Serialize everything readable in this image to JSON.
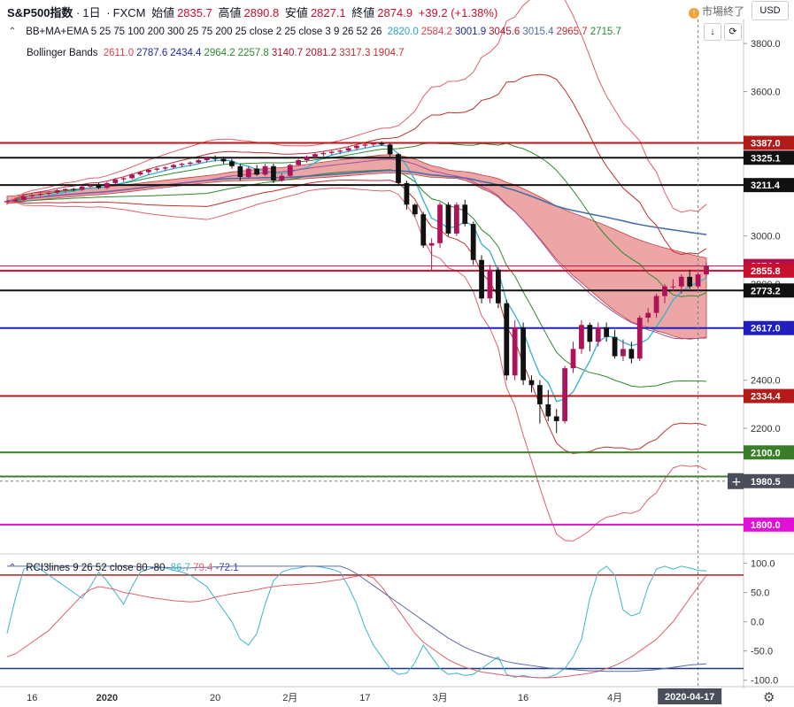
{
  "header": {
    "symbol": "S&P500指数",
    "interval": "1日",
    "source": "FXCM",
    "open_label": "始値",
    "open": "2835.7",
    "high_label": "高値",
    "high": "2890.8",
    "low_label": "安値",
    "low": "2827.1",
    "close_label": "終値",
    "close": "2874.9",
    "change": "+39.2 (+1.38%)",
    "market_status": "市場終了",
    "currency": "USD"
  },
  "indicators": {
    "main_name": "BB+MA+EMA 5 25 75 100 200 300 25 75 200 25 close 2 25 close 3 9 26 52 26",
    "main_values": [
      {
        "v": "2820.0",
        "color": "#26a6c9"
      },
      {
        "v": "2584.2",
        "color": "#e0404a"
      },
      {
        "v": "3001.9",
        "color": "#1e2aa0"
      },
      {
        "v": "3045.6",
        "color": "#b1122c"
      },
      {
        "v": "3015.4",
        "color": "#4a6fa5"
      },
      {
        "v": "2965.7",
        "color": "#c03030"
      },
      {
        "v": "2715.7",
        "color": "#2e8b2e"
      }
    ],
    "bb_name": "Bollinger Bands",
    "bb_values": [
      {
        "v": "2611.0",
        "color": "#e0404a"
      },
      {
        "v": "2787.6",
        "color": "#1e2aa0"
      },
      {
        "v": "2434.4",
        "color": "#1e2aa0"
      },
      {
        "v": "2964.2",
        "color": "#2e8b2e"
      },
      {
        "v": "2257.8",
        "color": "#2e8b2e"
      },
      {
        "v": "3140.7",
        "color": "#b1122c"
      },
      {
        "v": "2081.2",
        "color": "#b1122c"
      },
      {
        "v": "3317.3",
        "color": "#c03030"
      },
      {
        "v": "1904.7",
        "color": "#c03030"
      }
    ],
    "rci_name": "RCI3lines 9 26 52 close 80 -80",
    "rci_values": [
      {
        "v": "86.7",
        "color": "#3cb6cc"
      },
      {
        "v": "79.4",
        "color": "#e0606a"
      },
      {
        "v": "-72.1",
        "color": "#3b4a9a"
      }
    ]
  },
  "chart_data": {
    "type": "candlestick",
    "ylim": [
      1700,
      3900
    ],
    "yticks": [
      1800,
      2000,
      2200,
      2400,
      2600,
      2800,
      3000,
      3200,
      3400,
      3600,
      3800
    ],
    "ytick_labels": [
      "1800.0",
      "",
      "2200.0",
      "2400.0",
      "",
      "2800.0",
      "3000.0",
      "",
      "",
      "3600.0",
      "3800.0"
    ],
    "x_labels": [
      {
        "label": "16",
        "i": 3
      },
      {
        "label": "2020",
        "i": 12,
        "bold": true
      },
      {
        "label": "20",
        "i": 25
      },
      {
        "label": "2月",
        "i": 34
      },
      {
        "label": "17",
        "i": 43
      },
      {
        "label": "3月",
        "i": 52
      },
      {
        "label": "16",
        "i": 62
      },
      {
        "label": "4月",
        "i": 73
      },
      {
        "label": "2020-04-17",
        "i": 82,
        "box": true
      }
    ],
    "candles": [
      [
        3140,
        3150,
        3130,
        3145
      ],
      [
        3145,
        3160,
        3140,
        3150
      ],
      [
        3150,
        3168,
        3145,
        3165
      ],
      [
        3165,
        3175,
        3155,
        3170
      ],
      [
        3170,
        3180,
        3165,
        3175
      ],
      [
        3175,
        3182,
        3168,
        3180
      ],
      [
        3180,
        3195,
        3175,
        3190
      ],
      [
        3190,
        3198,
        3180,
        3195
      ],
      [
        3195,
        3200,
        3185,
        3192
      ],
      [
        3192,
        3210,
        3188,
        3205
      ],
      [
        3205,
        3215,
        3198,
        3210
      ],
      [
        3210,
        3220,
        3195,
        3200
      ],
      [
        3200,
        3225,
        3195,
        3220
      ],
      [
        3220,
        3240,
        3215,
        3235
      ],
      [
        3235,
        3245,
        3225,
        3240
      ],
      [
        3240,
        3260,
        3235,
        3255
      ],
      [
        3255,
        3270,
        3250,
        3265
      ],
      [
        3265,
        3280,
        3255,
        3275
      ],
      [
        3275,
        3285,
        3268,
        3280
      ],
      [
        3280,
        3290,
        3270,
        3285
      ],
      [
        3285,
        3300,
        3280,
        3295
      ],
      [
        3295,
        3305,
        3285,
        3300
      ],
      [
        3300,
        3310,
        3290,
        3305
      ],
      [
        3305,
        3320,
        3300,
        3315
      ],
      [
        3315,
        3330,
        3305,
        3325
      ],
      [
        3325,
        3335,
        3310,
        3320
      ],
      [
        3320,
        3330,
        3300,
        3310
      ],
      [
        3310,
        3320,
        3280,
        3290
      ],
      [
        3290,
        3300,
        3230,
        3245
      ],
      [
        3245,
        3290,
        3240,
        3280
      ],
      [
        3280,
        3295,
        3250,
        3255
      ],
      [
        3255,
        3300,
        3250,
        3290
      ],
      [
        3290,
        3300,
        3220,
        3230
      ],
      [
        3230,
        3260,
        3225,
        3250
      ],
      [
        3250,
        3300,
        3245,
        3295
      ],
      [
        3295,
        3320,
        3290,
        3315
      ],
      [
        3315,
        3335,
        3305,
        3330
      ],
      [
        3330,
        3345,
        3320,
        3340
      ],
      [
        3340,
        3350,
        3330,
        3345
      ],
      [
        3345,
        3355,
        3335,
        3350
      ],
      [
        3350,
        3360,
        3340,
        3355
      ],
      [
        3355,
        3370,
        3350,
        3365
      ],
      [
        3365,
        3380,
        3355,
        3375
      ],
      [
        3375,
        3385,
        3365,
        3380
      ],
      [
        3380,
        3390,
        3370,
        3385
      ],
      [
        3385,
        3393,
        3375,
        3380
      ],
      [
        3380,
        3385,
        3330,
        3340
      ],
      [
        3340,
        3345,
        3210,
        3220
      ],
      [
        3220,
        3230,
        3110,
        3130
      ],
      [
        3130,
        3135,
        3080,
        3090
      ],
      [
        3090,
        3100,
        2950,
        2960
      ],
      [
        2960,
        2990,
        2855,
        2970
      ],
      [
        2970,
        3140,
        2950,
        3130
      ],
      [
        3130,
        3140,
        3000,
        3010
      ],
      [
        3010,
        3140,
        3000,
        3130
      ],
      [
        3130,
        3150,
        3040,
        3050
      ],
      [
        3050,
        3060,
        2880,
        2900
      ],
      [
        2900,
        2920,
        2720,
        2740
      ],
      [
        2740,
        2880,
        2720,
        2860
      ],
      [
        2860,
        2870,
        2700,
        2720
      ],
      [
        2720,
        2735,
        2400,
        2420
      ],
      [
        2420,
        2650,
        2400,
        2620
      ],
      [
        2620,
        2640,
        2380,
        2400
      ],
      [
        2400,
        2420,
        2350,
        2380
      ],
      [
        2380,
        2400,
        2220,
        2300
      ],
      [
        2300,
        2360,
        2230,
        2250
      ],
      [
        2250,
        2280,
        2180,
        2230
      ],
      [
        2230,
        2460,
        2220,
        2450
      ],
      [
        2450,
        2560,
        2430,
        2530
      ],
      [
        2530,
        2650,
        2510,
        2630
      ],
      [
        2630,
        2640,
        2520,
        2560
      ],
      [
        2560,
        2640,
        2540,
        2620
      ],
      [
        2620,
        2640,
        2560,
        2580
      ],
      [
        2580,
        2610,
        2490,
        2500
      ],
      [
        2500,
        2570,
        2480,
        2530
      ],
      [
        2530,
        2560,
        2470,
        2490
      ],
      [
        2490,
        2670,
        2480,
        2660
      ],
      [
        2660,
        2700,
        2640,
        2680
      ],
      [
        2680,
        2760,
        2660,
        2750
      ],
      [
        2750,
        2800,
        2720,
        2790
      ],
      [
        2790,
        2820,
        2770,
        2790
      ],
      [
        2790,
        2840,
        2760,
        2830
      ],
      [
        2830,
        2860,
        2780,
        2790
      ],
      [
        2790,
        2850,
        2780,
        2840
      ],
      [
        2840,
        2891,
        2827,
        2875
      ]
    ],
    "horizontal_levels": [
      {
        "v": 3387,
        "label": "3387.0",
        "color": "#b51a1a",
        "width": 2
      },
      {
        "v": 3325.1,
        "label": "3325.1",
        "color": "#111111",
        "width": 2
      },
      {
        "v": 3211.4,
        "label": "3211.4",
        "color": "#111111",
        "width": 2
      },
      {
        "v": 2874.9,
        "label": "2874.9",
        "color": "#b0104e",
        "width": 1
      },
      {
        "v": 2855.8,
        "label": "2855.8",
        "color": "#c8102e",
        "width": 2
      },
      {
        "v": 2773.2,
        "label": "2773.2",
        "color": "#111111",
        "width": 2
      },
      {
        "v": 2617.0,
        "label": "2617.0",
        "color": "#2020c0",
        "width": 2
      },
      {
        "v": 2334.4,
        "label": "2334.4",
        "color": "#b51a1a",
        "width": 2
      },
      {
        "v": 2100.0,
        "label": "2100.0",
        "color": "#3a7d28",
        "width": 2
      },
      {
        "v": 2000.0,
        "label": "",
        "color": "#3a7d28",
        "width": 2
      },
      {
        "v": 1800.0,
        "label": "1800.0",
        "color": "#e010d8",
        "width": 2
      }
    ],
    "crosshair_price": "1980.5",
    "rci": {
      "ylim": [
        -105,
        110
      ],
      "yticks": [
        100,
        50,
        0,
        -50,
        -100
      ],
      "ytick_labels": [
        "100.0",
        "50.0",
        "0.0",
        "-50.0",
        "-100.0"
      ],
      "levels": [
        80,
        -80
      ],
      "short": [
        -20,
        40,
        90,
        95,
        90,
        80,
        70,
        60,
        50,
        40,
        60,
        85,
        70,
        50,
        30,
        60,
        85,
        90,
        95,
        92,
        88,
        85,
        80,
        70,
        60,
        40,
        20,
        0,
        -30,
        -40,
        -20,
        30,
        70,
        85,
        90,
        92,
        95,
        95,
        93,
        90,
        85,
        60,
        30,
        -10,
        -40,
        -60,
        -80,
        -90,
        -88,
        -70,
        -40,
        -60,
        -80,
        -90,
        -88,
        -92,
        -90,
        -80,
        -70,
        -60,
        -90,
        -95,
        -92,
        -95,
        -96,
        -95,
        -90,
        -80,
        -60,
        -30,
        40,
        85,
        95,
        80,
        20,
        10,
        15,
        60,
        90,
        95,
        90,
        95,
        92,
        88,
        87
      ],
      "mid": [
        -60,
        -55,
        -45,
        -35,
        -25,
        -15,
        0,
        15,
        30,
        45,
        55,
        60,
        58,
        55,
        50,
        48,
        45,
        42,
        40,
        38,
        36,
        35,
        34,
        35,
        38,
        42,
        45,
        48,
        50,
        52,
        55,
        58,
        60,
        62,
        63,
        64,
        65,
        66,
        68,
        70,
        72,
        75,
        78,
        80,
        75,
        60,
        40,
        20,
        0,
        -20,
        -35,
        -45,
        -55,
        -65,
        -72,
        -78,
        -82,
        -86,
        -88,
        -90,
        -92,
        -93,
        -94,
        -95,
        -96,
        -96,
        -95,
        -94,
        -92,
        -90,
        -88,
        -85,
        -80,
        -75,
        -68,
        -60,
        -50,
        -40,
        -30,
        -15,
        0,
        20,
        40,
        60,
        79
      ],
      "long": [
        95,
        95,
        95,
        95,
        95,
        95,
        95,
        95,
        95,
        95,
        95,
        95,
        95,
        95,
        95,
        95,
        94,
        94,
        93,
        93,
        92,
        92,
        92,
        93,
        93,
        94,
        94,
        95,
        95,
        95,
        95,
        95,
        95,
        95,
        95,
        95,
        95,
        95,
        95,
        95,
        95,
        90,
        82,
        72,
        62,
        52,
        42,
        32,
        22,
        12,
        2,
        -8,
        -18,
        -28,
        -36,
        -44,
        -50,
        -55,
        -60,
        -64,
        -68,
        -71,
        -73,
        -75,
        -77,
        -79,
        -80,
        -81,
        -82,
        -83,
        -84,
        -84,
        -85,
        -85,
        -85,
        -85,
        -84,
        -83,
        -82,
        -80,
        -78,
        -76,
        -74,
        -73,
        -72
      ]
    }
  }
}
